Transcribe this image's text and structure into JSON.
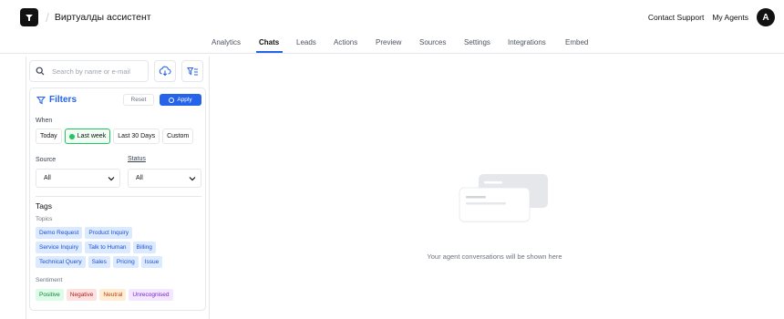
{
  "header": {
    "app_title": "Виртуалды ассистент",
    "contact_support": "Contact Support",
    "my_agents": "My Agents",
    "avatar_letter": "A"
  },
  "tabs": [
    {
      "label": "Analytics",
      "active": false
    },
    {
      "label": "Chats",
      "active": true
    },
    {
      "label": "Leads",
      "active": false
    },
    {
      "label": "Actions",
      "active": false
    },
    {
      "label": "Preview",
      "active": false
    },
    {
      "label": "Sources",
      "active": false
    },
    {
      "label": "Settings",
      "active": false
    },
    {
      "label": "Integrations",
      "active": false
    },
    {
      "label": "Embed",
      "active": false
    }
  ],
  "search": {
    "placeholder": "Search by name or e-mail"
  },
  "filters": {
    "title": "Filters",
    "reset_label": "Reset",
    "apply_label": "Apply",
    "when_label": "When",
    "when_options": [
      "Today",
      "Last week",
      "Last 30 Days",
      "Custom"
    ],
    "when_selected": "Last week",
    "source_label": "Source",
    "source_value": "All",
    "status_label": "Status",
    "status_value": "All",
    "tags_title": "Tags",
    "topics_label": "Topics",
    "topics": [
      [
        "Demo Request",
        "Product Inquiry"
      ],
      [
        "Service Inquiry",
        "Talk to Human",
        "Billing"
      ],
      [
        "Technical Query",
        "Sales",
        "Pricing",
        "Issue"
      ]
    ],
    "sentiment_label": "Sentiment",
    "sentiment": [
      "Positive",
      "Negative",
      "Neutral",
      "Unrecognised"
    ]
  },
  "empty_state": {
    "message": "Your agent conversations will be shown here"
  },
  "colors": {
    "accent": "#2563eb",
    "selected_green": "#22c55e"
  }
}
